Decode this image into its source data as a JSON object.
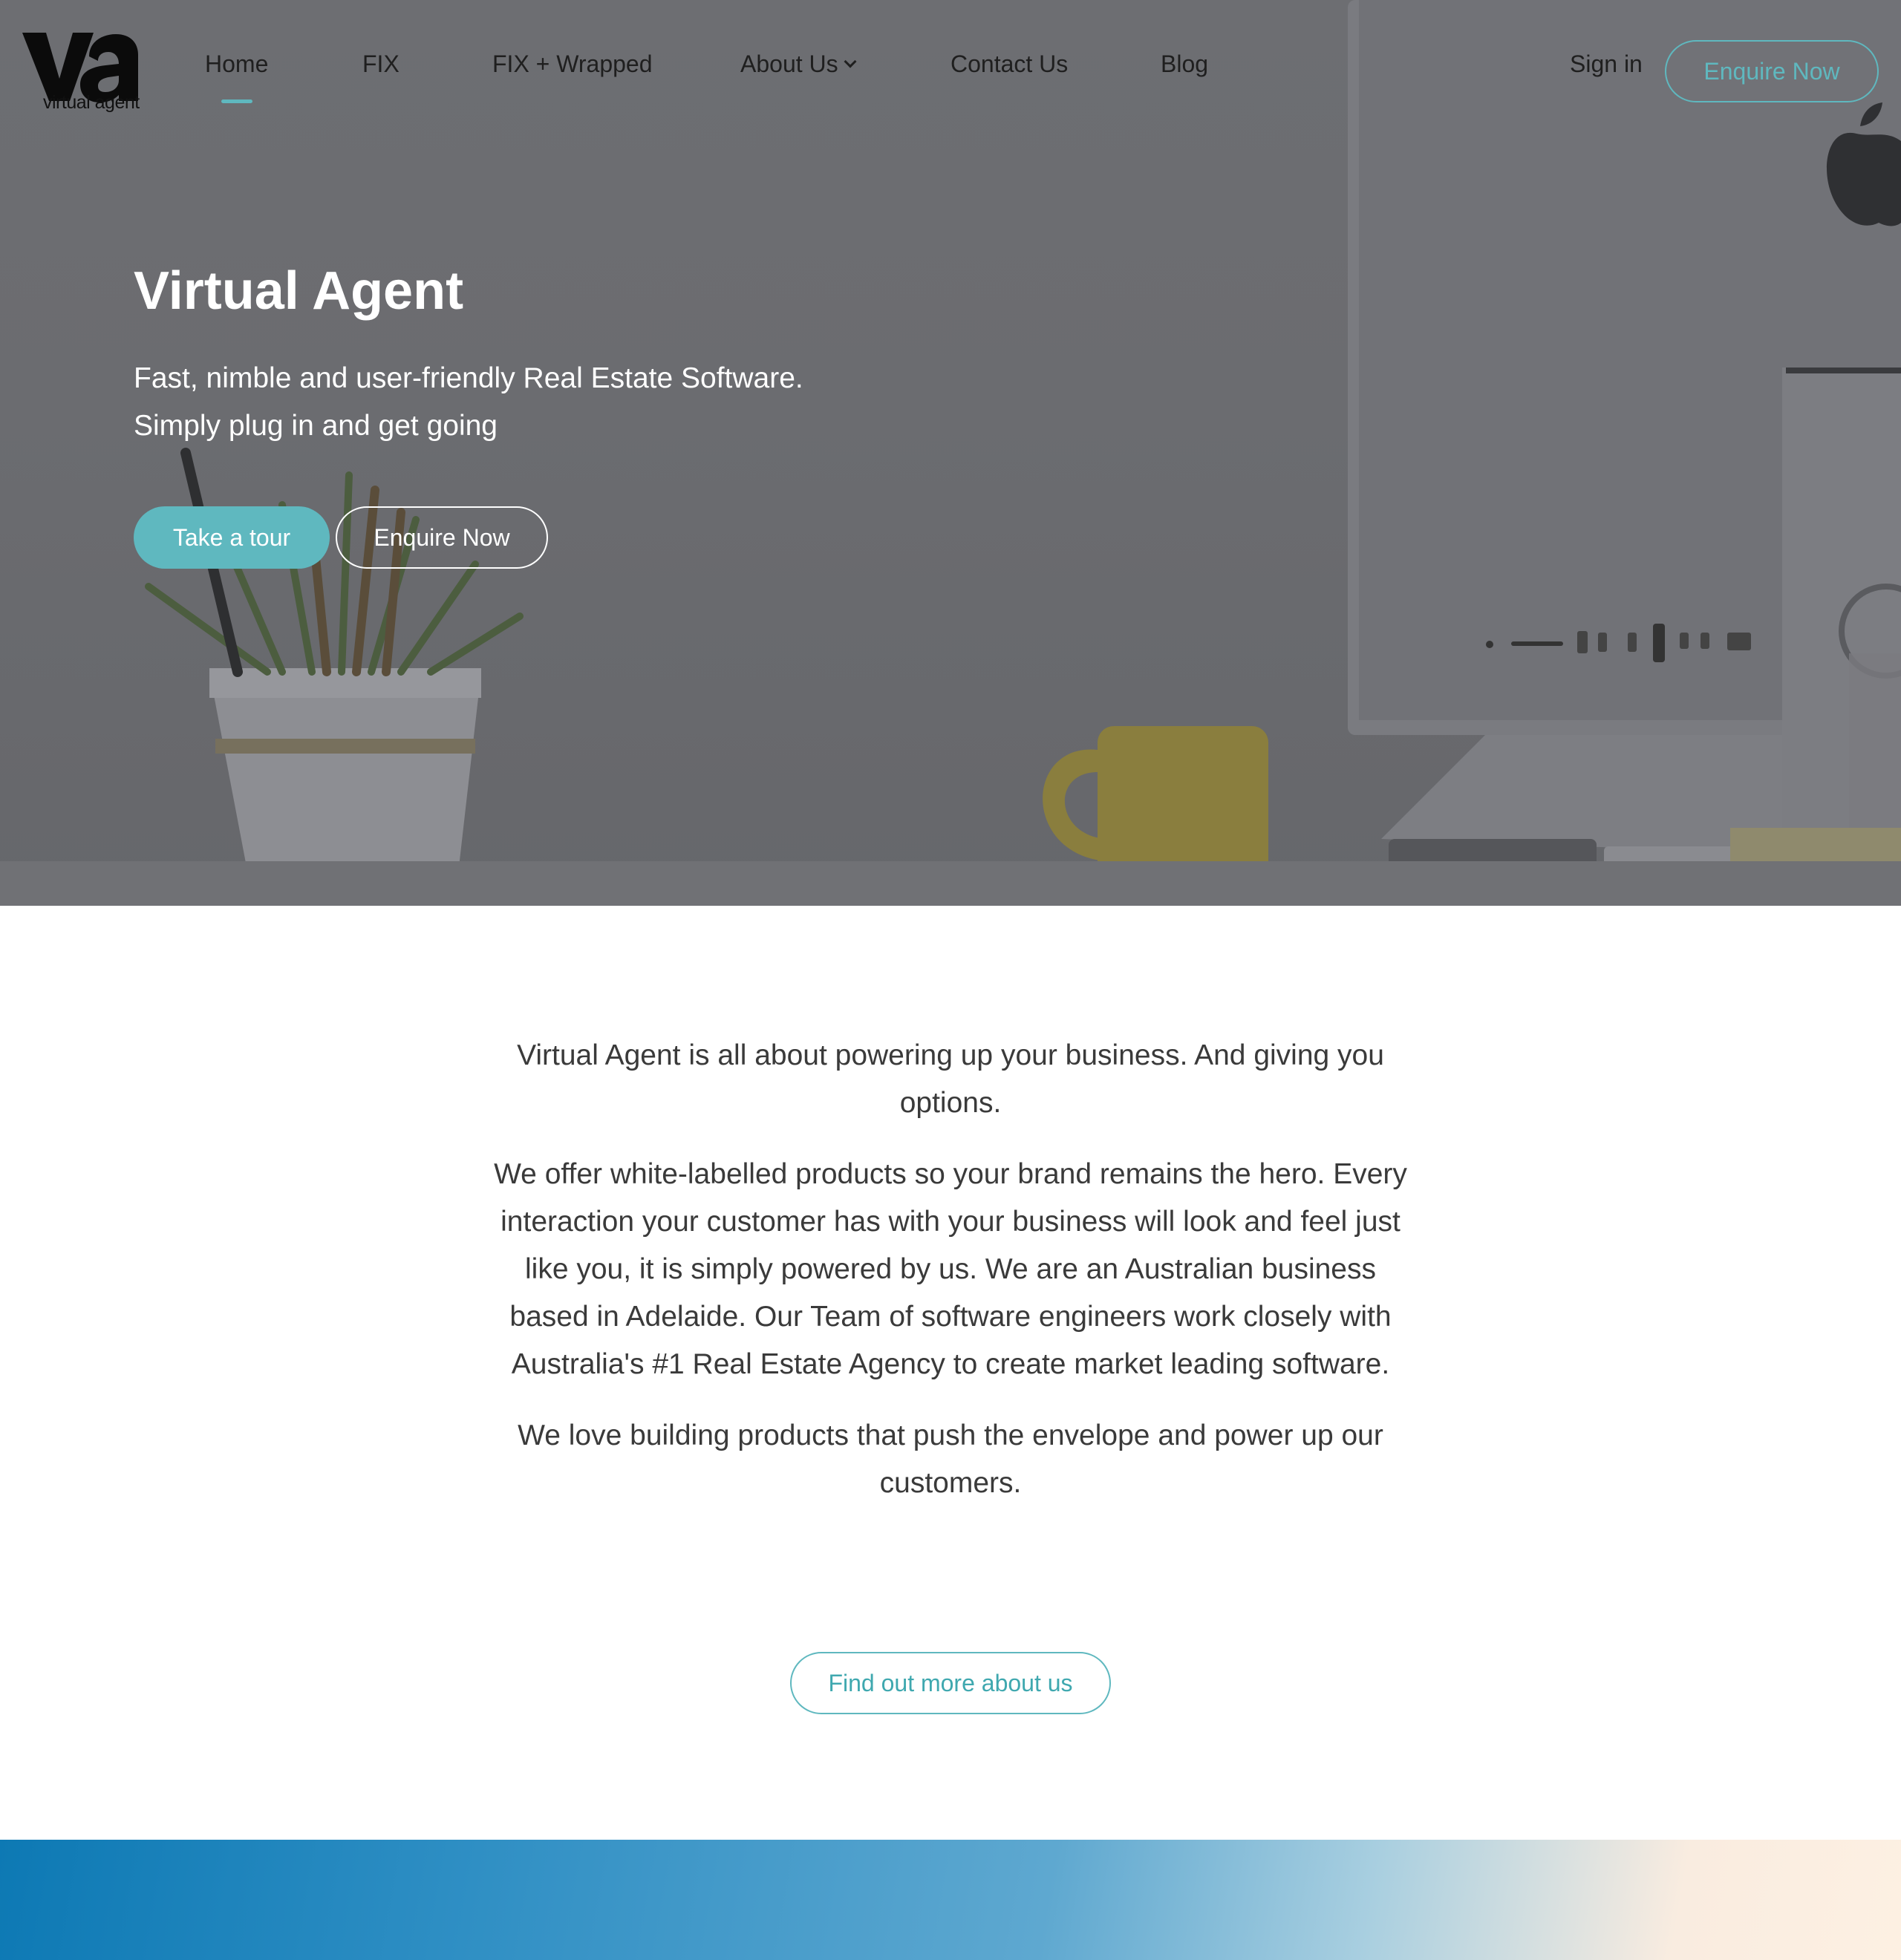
{
  "brand": {
    "logo_text": "virtual agent",
    "accent_color": "#5fb8bf"
  },
  "nav": {
    "items": [
      {
        "label": "Home",
        "active": true
      },
      {
        "label": "FIX"
      },
      {
        "label": "FIX + Wrapped"
      },
      {
        "label": "About Us",
        "has_dropdown": true
      },
      {
        "label": "Contact Us"
      },
      {
        "label": "Blog"
      }
    ],
    "sign_in": "Sign in",
    "enquire": "Enquire Now"
  },
  "hero": {
    "title": "Virtual Agent",
    "subtitle_line1": "Fast, nimble and user-friendly Real Estate Software.",
    "subtitle_line2": "Simply plug in and get going",
    "primary_button": "Take a tour",
    "secondary_button": "Enquire Now"
  },
  "about": {
    "paragraphs": [
      "Virtual Agent is all about powering up your business. And giving you options.",
      "We offer white-labelled products so your brand remains the hero. Every interaction your customer has with your business will look and feel just like you, it is simply powered by us. We are an Australian business based in Adelaide. Our Team of software engineers work closely with Australia's #1 Real Estate Agency to create market leading software.",
      "We love building products that push the envelope and power up our customers."
    ],
    "button": "Find out more about us"
  }
}
